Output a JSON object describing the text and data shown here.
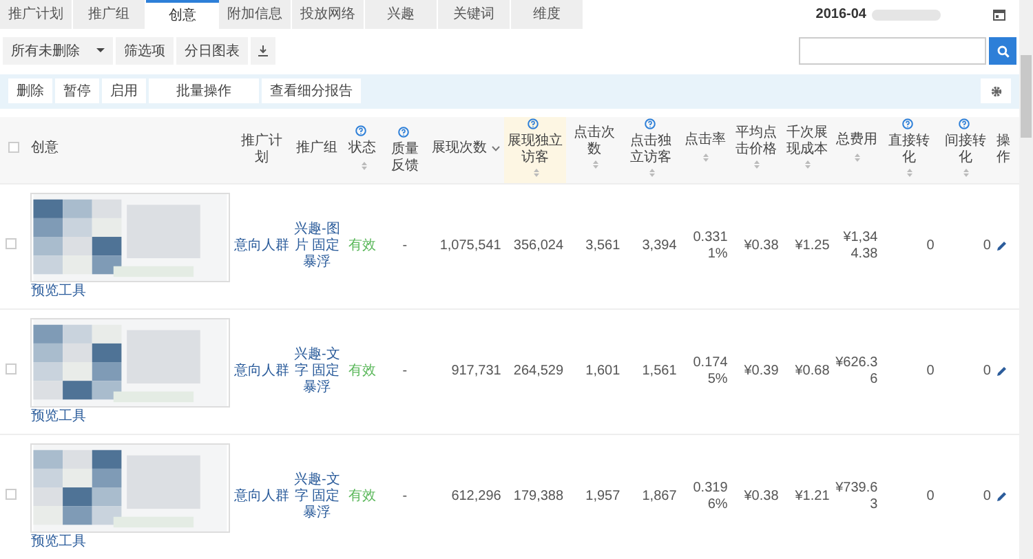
{
  "tabs": [
    {
      "label": "推广计划",
      "selected": false
    },
    {
      "label": "推广组",
      "selected": false
    },
    {
      "label": "创意",
      "selected": true
    },
    {
      "label": "附加信息",
      "selected": false
    },
    {
      "label": "投放网络",
      "selected": false
    },
    {
      "label": "兴趣",
      "selected": false
    },
    {
      "label": "关键词",
      "selected": false
    },
    {
      "label": "维度",
      "selected": false
    }
  ],
  "date": "2016-04",
  "toolbar": {
    "filter": "所有未删除",
    "buttons": [
      "筛选项",
      "分日图表"
    ]
  },
  "actions": [
    "删除",
    "暂停",
    "启用",
    "批量操作",
    "查看细分报告"
  ],
  "table": {
    "header_checked": false,
    "columns": [
      {
        "label": "创意",
        "kind": "creative"
      },
      {
        "label": "推广计划",
        "kind": "link"
      },
      {
        "label": "推广组",
        "kind": "link"
      },
      {
        "label": "状态",
        "kind": "status",
        "help": true,
        "sortable": true
      },
      {
        "label": "质量反馈",
        "kind": "text",
        "help": true
      },
      {
        "label": "展现次数",
        "kind": "number",
        "sorted": true
      },
      {
        "label": "展现独立访客",
        "kind": "number",
        "help": true,
        "sortable": true,
        "highlighted": true
      },
      {
        "label": "点击次数",
        "kind": "number",
        "sortable": true
      },
      {
        "label": "点击独立访客",
        "kind": "number",
        "help": true,
        "sortable": true
      },
      {
        "label": "点击率",
        "kind": "number",
        "sortable": true
      },
      {
        "label": "平均点击价格",
        "kind": "number",
        "sortable": true
      },
      {
        "label": "千次展现成本",
        "kind": "number",
        "sortable": true
      },
      {
        "label": "总费用",
        "kind": "number",
        "sortable": true
      },
      {
        "label": "直接转化",
        "kind": "number",
        "help": true,
        "sortable": true
      },
      {
        "label": "间接转化",
        "kind": "number",
        "help": true,
        "sortable": true
      },
      {
        "label": "操作",
        "kind": "action"
      }
    ],
    "rows": [
      {
        "checked": false,
        "cells": [
          "预览工具",
          "意向人群",
          "兴趣-图片 固定暴浮",
          "有效",
          "-",
          "1,075,541",
          "356,024",
          "3,561",
          "3,394",
          "0.3311%",
          "¥0.38",
          "¥1.25",
          "¥1,344.38",
          "0",
          "0"
        ]
      },
      {
        "checked": false,
        "cells": [
          "预览工具",
          "意向人群",
          "兴趣-文字 固定暴浮",
          "有效",
          "-",
          "917,731",
          "264,529",
          "1,601",
          "1,561",
          "0.1745%",
          "¥0.39",
          "¥0.68",
          "¥626.36",
          "0",
          "0"
        ]
      },
      {
        "checked": false,
        "cells": [
          "预览工具",
          "意向人群",
          "兴趣-文字 固定暴浮",
          "有效",
          "-",
          "612,296",
          "179,388",
          "1,957",
          "1,867",
          "0.3196%",
          "¥0.38",
          "¥1.21",
          "¥739.63",
          "0",
          "0"
        ]
      }
    ]
  }
}
